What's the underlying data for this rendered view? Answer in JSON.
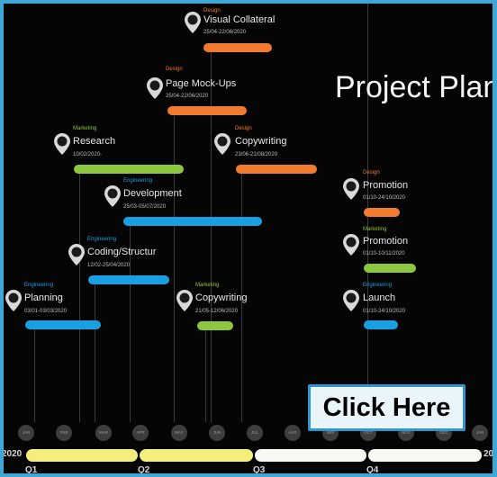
{
  "title": "Project Plan",
  "cta_label": "Click Here",
  "colors": {
    "design": "#f07a2d",
    "marketing": "#8dc63f",
    "engineering": "#1a9fe0",
    "quarter_yellow": "#f4ee7a",
    "quarter_white": "#f8f8f2"
  },
  "tasks": [
    {
      "category": "Design",
      "name": "Visual Collateral",
      "dates": "25/04-22/06/2020",
      "color": "design"
    },
    {
      "category": "Design",
      "name": "Page Mock-Ups",
      "dates": "25/04-22/06/2020",
      "color": "design"
    },
    {
      "category": "Marketing",
      "name": "Research",
      "dates": "10/02/2020-",
      "color": "marketing"
    },
    {
      "category": "Design",
      "name": "Copywriting",
      "dates": "23/06-21/08/2020",
      "color": "design"
    },
    {
      "category": "Engineering",
      "name": "Development",
      "dates": "25/03-05/07/2020",
      "color": "engineering"
    },
    {
      "category": "Design",
      "name": "Promotion",
      "dates": "01/10-24/10/2020",
      "color": "design"
    },
    {
      "category": "Marketing",
      "name": "Promotion",
      "dates": "01/10-10/11/2020",
      "color": "marketing"
    },
    {
      "category": "Engineering",
      "name": "Coding/Structur",
      "dates": "12/02-25/04/2020",
      "color": "engineering"
    },
    {
      "category": "Engineering",
      "name": "Planning",
      "dates": "03/01-03/03/2020",
      "color": "engineering"
    },
    {
      "category": "Marketing",
      "name": "Copywriting",
      "dates": "21/05-12/06/2020",
      "color": "marketing"
    },
    {
      "category": "Engineering",
      "name": "Launch",
      "dates": "01/10-24/10/2020",
      "color": "engineering"
    }
  ],
  "months": [
    "JAN",
    "FEB",
    "MAR",
    "APR",
    "MAY",
    "JUN",
    "JUL",
    "AUG",
    "SEP",
    "OCT",
    "NOV",
    "DEC",
    "JAN"
  ],
  "year_start": "2020",
  "year_end": "20",
  "quarters": [
    "Q1",
    "Q2",
    "Q3",
    "Q4"
  ]
}
